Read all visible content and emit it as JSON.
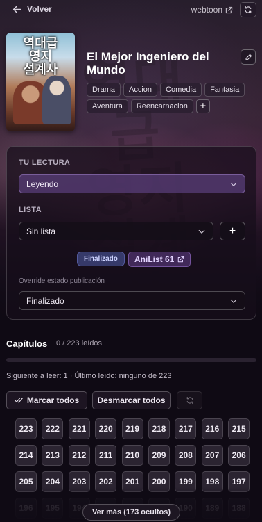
{
  "nav": {
    "back_label": "Volver",
    "source_label": "webtoon"
  },
  "series": {
    "cover_title": "역대급\n영지\n설계사",
    "title": "El Mejor Ingeniero del Mundo",
    "tags": [
      "Drama",
      "Accion",
      "Comedia",
      "Fantasia",
      "Aventura",
      "Reencarnacion"
    ],
    "add_tag_label": "+"
  },
  "reading": {
    "section_label": "TU LECTURA",
    "status_value": "Leyendo",
    "list_section_label": "LISTA",
    "list_value": "Sin lista",
    "add_list_label": "+",
    "publication_badge": "Finalizado",
    "anilist_badge": "AniList 61",
    "override_label": "Override estado publicación",
    "override_value": "Finalizado"
  },
  "chapters": {
    "title": "Capítulos",
    "count_label": "0 / 223 leídos",
    "read": 0,
    "total": 223,
    "progress_fraction": 0,
    "next_label": "Siguiente a leer: 1 · Último leído: ninguno de 223",
    "mark_all_label": "Marcar todos",
    "unmark_all_label": "Desmarcar todos",
    "visible_numbers": [
      223,
      222,
      221,
      220,
      219,
      218,
      217,
      216,
      215,
      214,
      213,
      212,
      211,
      210,
      209,
      208,
      207,
      206,
      205,
      204,
      203,
      202,
      201,
      200,
      199,
      198,
      197,
      196,
      195,
      194,
      193,
      192,
      191,
      190,
      189,
      188
    ],
    "show_more_label": "Ver más (173 ocultos)"
  },
  "colors": {
    "accent": "#8a6ad0",
    "reading_select": "#583e78",
    "background": "#0f0a14"
  },
  "icons": [
    "arrow-left-icon",
    "external-link-icon",
    "refresh-icon",
    "pencil-icon",
    "chevron-down-icon",
    "double-check-icon"
  ]
}
